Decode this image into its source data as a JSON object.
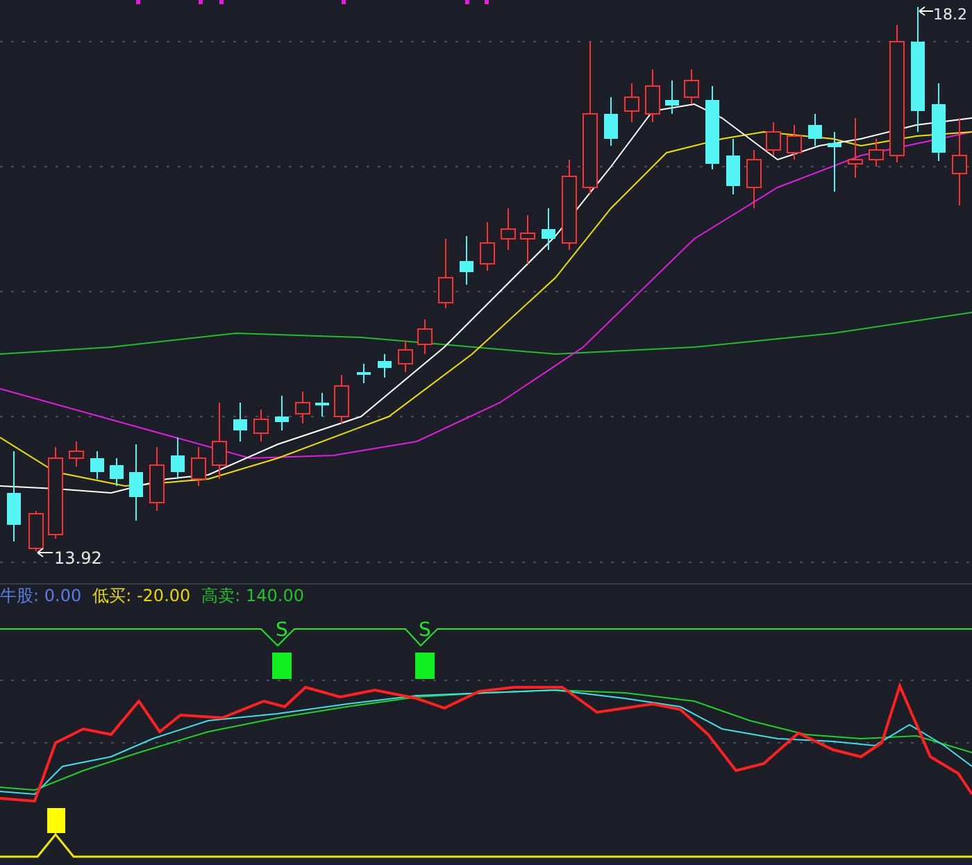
{
  "price_panel": {
    "high_label": "18.2",
    "low_label": "13.92"
  },
  "indicator_panel": {
    "legend": [
      {
        "label": "牛股:",
        "value": "0.00",
        "color": "#5b7fe8"
      },
      {
        "label": "低买:",
        "value": "-20.00",
        "color": "#e8d800"
      },
      {
        "label": "高卖:",
        "value": "140.00",
        "color": "#22c42a"
      }
    ],
    "signals": [
      {
        "label": "S"
      },
      {
        "label": "S"
      }
    ]
  }
}
